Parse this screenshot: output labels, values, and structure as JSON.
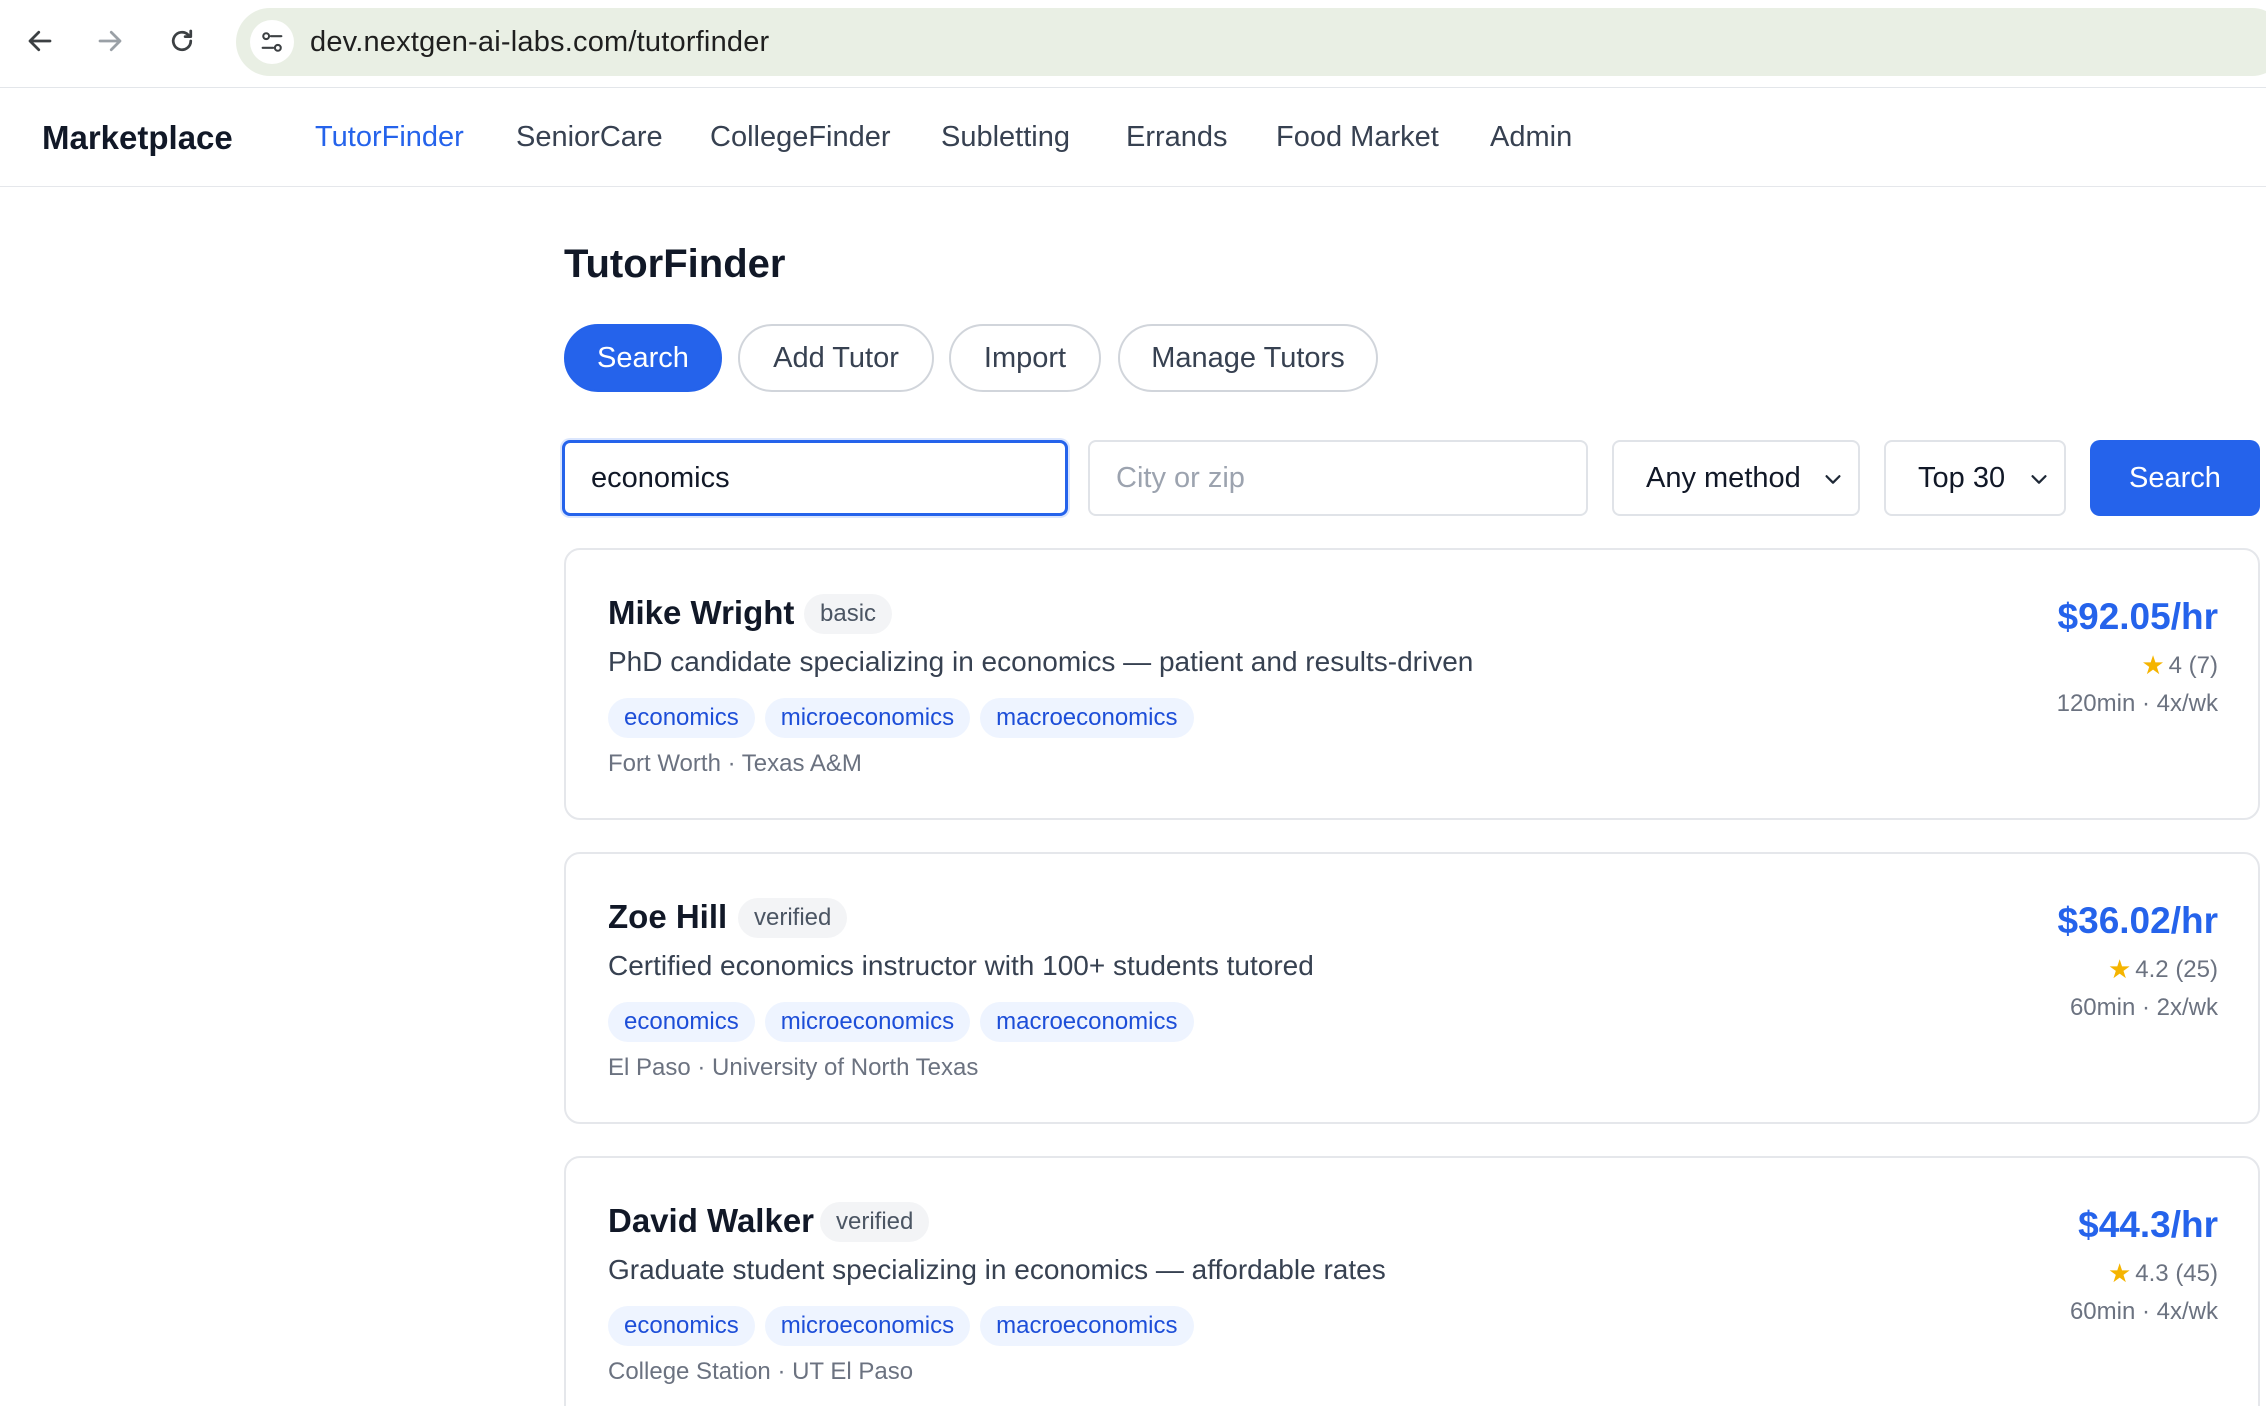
{
  "browser": {
    "url": "dev.nextgen-ai-labs.com/tutorfinder"
  },
  "header": {
    "brand": "Marketplace",
    "nav": [
      {
        "label": "TutorFinder"
      },
      {
        "label": "SeniorCare"
      },
      {
        "label": "CollegeFinder"
      },
      {
        "label": "Subletting"
      },
      {
        "label": "Errands"
      },
      {
        "label": "Food Market"
      },
      {
        "label": "Admin"
      }
    ]
  },
  "main": {
    "title": "TutorFinder",
    "tabs": [
      {
        "label": "Search"
      },
      {
        "label": "Add Tutor"
      },
      {
        "label": "Import"
      },
      {
        "label": "Manage Tutors"
      }
    ],
    "search": {
      "query_value": "economics",
      "location_placeholder": "City or zip",
      "method_selected": "Any method",
      "limit_selected": "Top 30",
      "button_label": "Search"
    },
    "results": [
      {
        "name": "Mike Wright",
        "badge": "basic",
        "description": "PhD candidate specializing in economics — patient and results-driven",
        "tags": [
          "economics",
          "microeconomics",
          "macroeconomics"
        ],
        "location": "Fort Worth · Texas A&M",
        "price": "$92.05/hr",
        "rating": "4 (7)",
        "schedule": "120min · 4x/wk"
      },
      {
        "name": "Zoe Hill",
        "badge": "verified",
        "description": "Certified economics instructor with 100+ students tutored",
        "tags": [
          "economics",
          "microeconomics",
          "macroeconomics"
        ],
        "location": "El Paso · University of North Texas",
        "price": "$36.02/hr",
        "rating": "4.2 (25)",
        "schedule": "60min · 2x/wk"
      },
      {
        "name": "David Walker",
        "badge": "verified",
        "description": "Graduate student specializing in economics — affordable rates",
        "tags": [
          "economics",
          "microeconomics",
          "macroeconomics"
        ],
        "location": "College Station · UT El Paso",
        "price": "$44.3/hr",
        "rating": "4.3 (45)",
        "schedule": "60min · 4x/wk"
      }
    ]
  },
  "colors": {
    "accent": "#2563eb",
    "star": "#f5b400"
  }
}
